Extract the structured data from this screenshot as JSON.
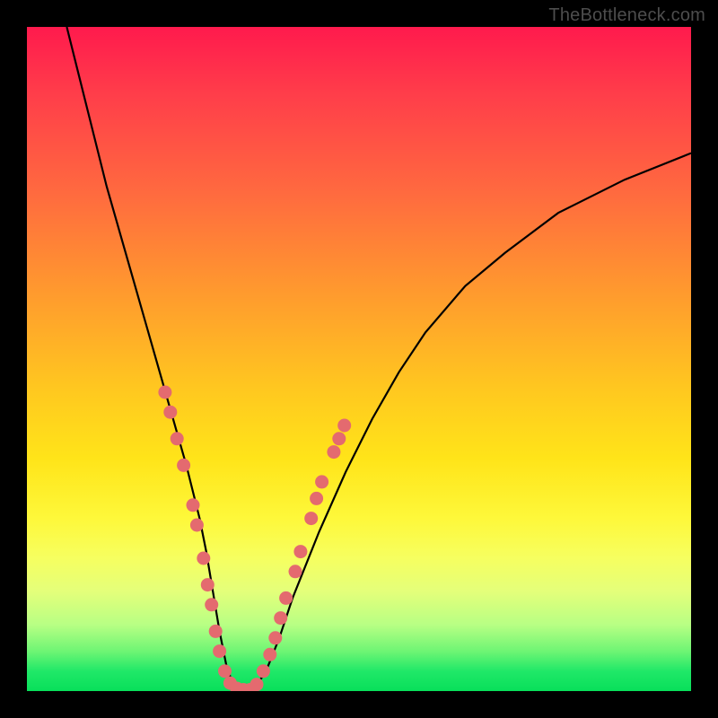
{
  "watermark": "TheBottleneck.com",
  "chart_data": {
    "type": "line",
    "title": "",
    "xlabel": "",
    "ylabel": "",
    "xlim": [
      0,
      100
    ],
    "ylim": [
      0,
      100
    ],
    "series": [
      {
        "name": "bottleneck-curve",
        "x": [
          6,
          8,
          10,
          12,
          14,
          16,
          18,
          20,
          22,
          24,
          26,
          27,
          28,
          29,
          30,
          31,
          32,
          34,
          36,
          38,
          40,
          44,
          48,
          52,
          56,
          60,
          66,
          72,
          80,
          90,
          100
        ],
        "y": [
          100,
          92,
          84,
          76,
          69,
          62,
          55,
          48,
          41,
          34,
          26,
          21,
          15,
          9,
          4,
          1,
          0,
          0,
          3,
          8,
          14,
          24,
          33,
          41,
          48,
          54,
          61,
          66,
          72,
          77,
          81
        ]
      }
    ],
    "markers": {
      "name": "dotted-highlight",
      "color": "#e46a6f",
      "points": [
        {
          "x": 20.8,
          "y": 45
        },
        {
          "x": 21.6,
          "y": 42
        },
        {
          "x": 22.6,
          "y": 38
        },
        {
          "x": 23.6,
          "y": 34
        },
        {
          "x": 25.0,
          "y": 28
        },
        {
          "x": 25.6,
          "y": 25
        },
        {
          "x": 26.6,
          "y": 20
        },
        {
          "x": 27.2,
          "y": 16
        },
        {
          "x": 27.8,
          "y": 13
        },
        {
          "x": 28.4,
          "y": 9
        },
        {
          "x": 29.0,
          "y": 6
        },
        {
          "x": 29.8,
          "y": 3
        },
        {
          "x": 30.6,
          "y": 1.2
        },
        {
          "x": 31.6,
          "y": 0.4
        },
        {
          "x": 32.6,
          "y": 0.2
        },
        {
          "x": 33.6,
          "y": 0.2
        },
        {
          "x": 34.6,
          "y": 1.0
        },
        {
          "x": 35.6,
          "y": 3.0
        },
        {
          "x": 36.6,
          "y": 5.5
        },
        {
          "x": 37.4,
          "y": 8.0
        },
        {
          "x": 38.2,
          "y": 11.0
        },
        {
          "x": 39.0,
          "y": 14.0
        },
        {
          "x": 40.4,
          "y": 18.0
        },
        {
          "x": 41.2,
          "y": 21.0
        },
        {
          "x": 42.8,
          "y": 26.0
        },
        {
          "x": 43.6,
          "y": 29.0
        },
        {
          "x": 44.4,
          "y": 31.5
        },
        {
          "x": 46.2,
          "y": 36.0
        },
        {
          "x": 47.0,
          "y": 38.0
        },
        {
          "x": 47.8,
          "y": 40.0
        }
      ]
    },
    "gradient_stops": [
      {
        "pos": 0,
        "color": "#ff1a4d"
      },
      {
        "pos": 25,
        "color": "#ff6a3f"
      },
      {
        "pos": 55,
        "color": "#ffc91f"
      },
      {
        "pos": 80,
        "color": "#f6ff60"
      },
      {
        "pos": 100,
        "color": "#08df5a"
      }
    ]
  }
}
